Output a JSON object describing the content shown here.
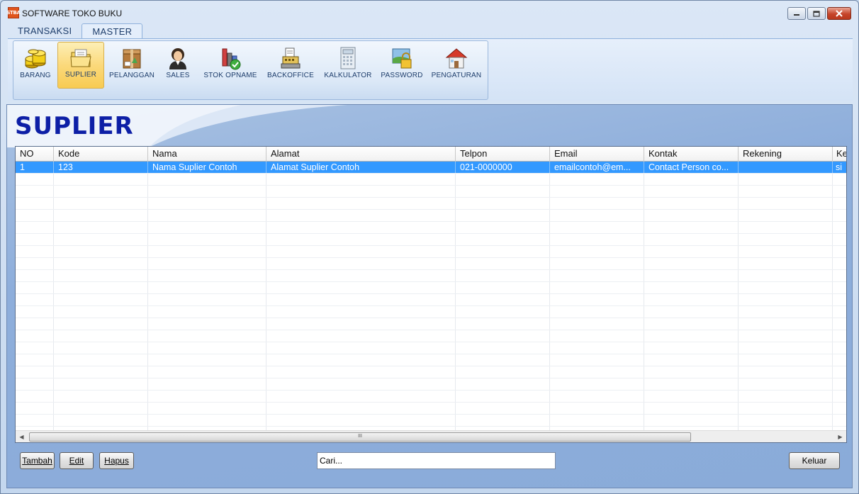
{
  "window": {
    "title": "SOFTWARE TOKO BUKU",
    "icon_text": "STBA"
  },
  "ribbon": {
    "tabs": [
      {
        "label": "TRANSAKSI",
        "active": false
      },
      {
        "label": "MASTER",
        "active": true
      }
    ],
    "buttons": [
      {
        "label": "BARANG",
        "icon": "coins-icon",
        "selected": false
      },
      {
        "label": "SUPLIER",
        "icon": "folder-icon",
        "selected": true
      },
      {
        "label": "PELANGGAN",
        "icon": "package-icon",
        "selected": false
      },
      {
        "label": "SALES",
        "icon": "person-icon",
        "selected": false
      },
      {
        "label": "STOK OPNAME",
        "icon": "chart-check-icon",
        "selected": false
      },
      {
        "label": "BACKOFFICE",
        "icon": "cash-register-icon",
        "selected": false
      },
      {
        "label": "KALKULATOR",
        "icon": "calculator-icon",
        "selected": false
      },
      {
        "label": "PASSWORD",
        "icon": "lock-icon",
        "selected": false
      },
      {
        "label": "PENGATURAN",
        "icon": "house-icon",
        "selected": false
      }
    ]
  },
  "page": {
    "title": "SUPLIER"
  },
  "grid": {
    "columns": [
      "NO",
      "Kode",
      "Nama",
      "Alamat",
      "Telpon",
      "Email",
      "Kontak",
      "Rekening",
      "Ke"
    ],
    "rows": [
      {
        "selected": true,
        "cells": [
          "1",
          "123",
          "Nama Suplier Contoh",
          "Alamat Suplier Contoh",
          "021-0000000",
          "emailcontoh@em...",
          "Contact Person co...",
          "",
          "si"
        ]
      }
    ],
    "scroll_grip": "III"
  },
  "footer": {
    "tambah_label": "Tambah",
    "edit_label": "Edit",
    "hapus_label": "Hapus",
    "search_value": "Cari...",
    "keluar_label": "Keluar"
  },
  "colors": {
    "selected_row": "#3399ff",
    "title_blue": "#0d1fa6",
    "ribbon_selected": "#fbd97b"
  }
}
